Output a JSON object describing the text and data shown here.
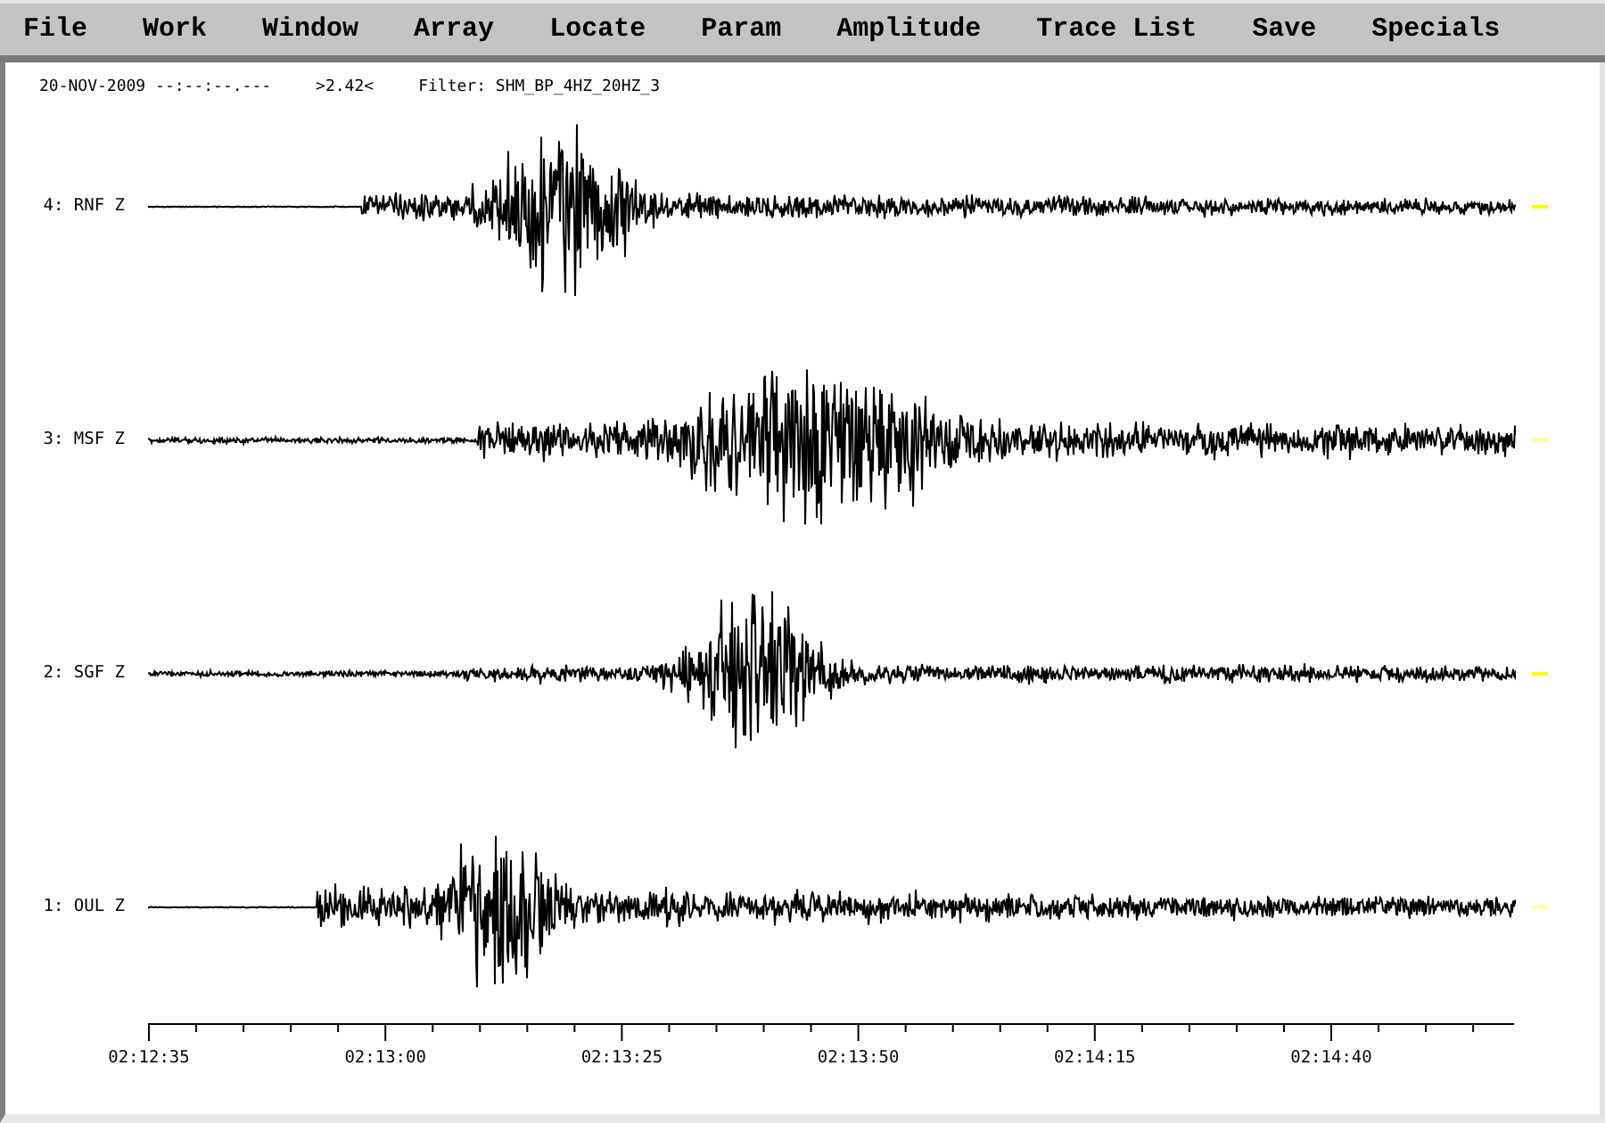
{
  "menu": [
    "File",
    "Work",
    "Window",
    "Array",
    "Locate",
    "Param",
    "Amplitude",
    "Trace List",
    "Save",
    "Specials"
  ],
  "header": {
    "date": "20-NOV-2009 --:--:--.---",
    "amplitude": ">2.42<",
    "filter": "Filter: SHM_BP_4HZ_20HZ_3"
  },
  "traces": [
    {
      "label": "4: RNF Z",
      "color": "#ffff00"
    },
    {
      "label": "3: MSF Z",
      "color": "#ffff99"
    },
    {
      "label": "2: SGF Z",
      "color": "#ffff00"
    },
    {
      "label": "1: OUL Z",
      "color": "#ffff99"
    }
  ],
  "time_axis": {
    "labels": [
      "02:12:35",
      "02:13:00",
      "02:13:25",
      "02:13:50",
      "02:14:15",
      "02:14:40"
    ]
  }
}
